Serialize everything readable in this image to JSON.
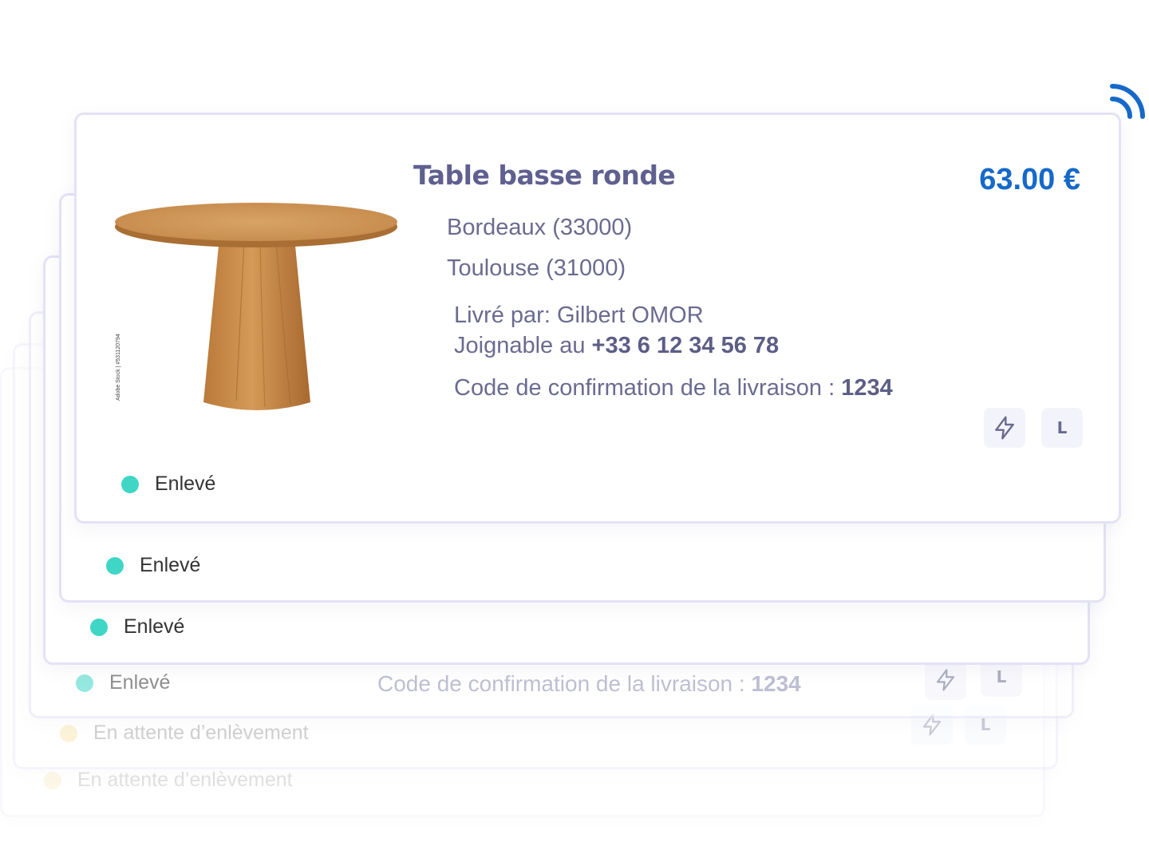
{
  "item": {
    "title": "Table basse ronde",
    "price": "63.00 €",
    "from_city": "Bordeaux (33000)",
    "to_city": "Toulouse (31000)",
    "delivered_by_label": "Livré par:",
    "driver_name": "Gilbert OMOR",
    "phone_label": "Joignable au",
    "phone": "+33 6 12 34 56 78",
    "code_label": "Code de confirmation de la livraison :",
    "code": "1234",
    "image_watermark": "Adobe Stock | #531120794",
    "size_badge": "L",
    "express_icon": "lightning-icon",
    "signal_icon": "wifi-signal-icon"
  },
  "cards": [
    {
      "status": "Enlevé",
      "status_color": "#3fd6c5"
    },
    {
      "status": "Enlevé",
      "status_color": "#3fd6c5"
    },
    {
      "status": "Enlevé",
      "status_color": "#3fd6c5"
    },
    {
      "status": "Enlevé",
      "status_color": "#3fd6c5"
    },
    {
      "status": "En attente d’enlèvement",
      "status_color": "#f6dc92"
    },
    {
      "status": "En attente d’enlèvement",
      "status_color": "#f6dc92"
    }
  ],
  "colors": {
    "accent": "#1669c9",
    "text": "#6a6b90",
    "border": "#e3e2f6",
    "status_picked": "#3fd6c5",
    "status_waiting": "#f6dc92"
  }
}
